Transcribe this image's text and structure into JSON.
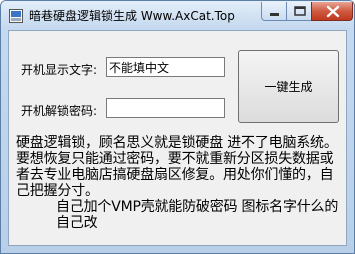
{
  "window": {
    "title": "暗巷硬盘逻辑锁生成 Www.AxCat.Top",
    "icon": "app-icon",
    "controls": [
      "minimize-icon",
      "maximize-icon",
      "close-icon"
    ]
  },
  "form": {
    "display_label": "开机显示文字:",
    "display_value": "不能填中文",
    "unlock_label": "开机解锁密码:",
    "unlock_value": "",
    "generate_label": "一键生成"
  },
  "info": {
    "paragraph1": "硬盘逻辑锁，顾名思义就是锁硬盘 进不了电脑系统。要想恢复只能通过密码，要不就重新分区损失数据或者去专业电脑店搞硬盘扇区修复。用处你们懂的，自己把握分寸。",
    "paragraph2": "自己加个VMP壳就能防破密码 图标名字什么的自己改"
  },
  "colors": {
    "frame": "#c5d9ef",
    "client": "#f0f0f0",
    "close_button": "#c1381d"
  }
}
